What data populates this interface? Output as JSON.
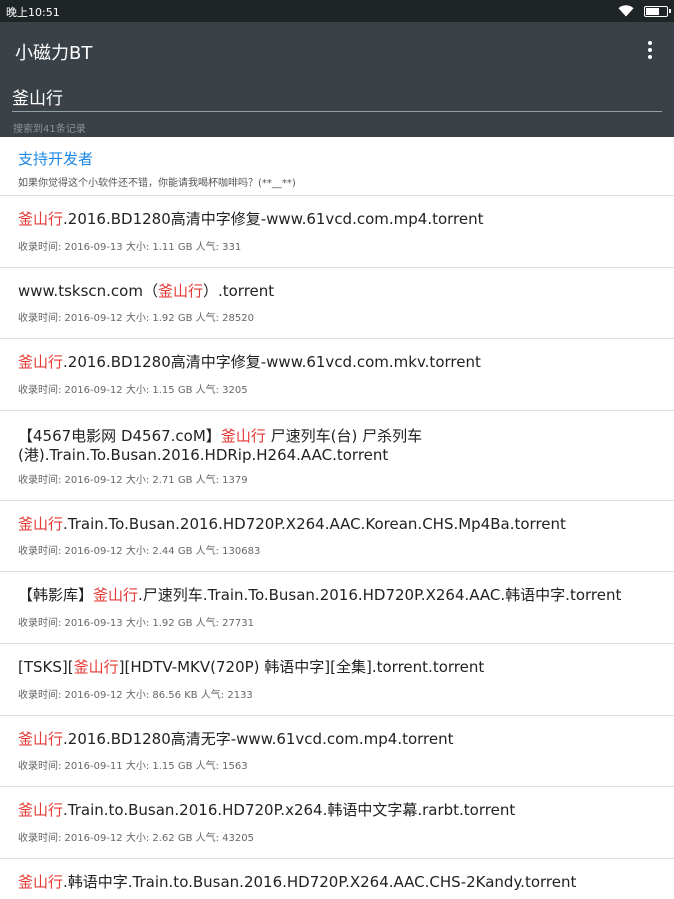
{
  "status_bar": {
    "time": "晚上10:51"
  },
  "app_bar": {
    "title": "小磁力BT",
    "search_value": "釜山行",
    "result_count": "搜索到41条记录"
  },
  "support": {
    "title": "支持开发者",
    "subtitle": "如果你觉得这个小软件还不错，你能请我喝杯咖啡吗？(**__**)"
  },
  "results": [
    {
      "pre": "",
      "hl": "釜山行",
      "post": ".2016.BD1280高清中字修复-www.61vcd.com.mp4.torrent",
      "meta": "收录时间: 2016-09-13 大小: 1.11 GB 人气: 331"
    },
    {
      "pre": "www.tskscn.com（",
      "hl": "釜山行",
      "post": "）.torrent",
      "meta": "收录时间: 2016-09-12 大小: 1.92 GB 人气: 28520"
    },
    {
      "pre": "",
      "hl": "釜山行",
      "post": ".2016.BD1280高清中字修复-www.61vcd.com.mkv.torrent",
      "meta": "收录时间: 2016-09-12 大小: 1.15 GB 人气: 3205"
    },
    {
      "pre": "【4567电影网 D4567.coM】",
      "hl": "釜山行",
      "post": " 尸速列车(台) 尸杀列车(港).Train.To.Busan.2016.HDRip.H264.AAC.torrent",
      "meta": "收录时间: 2016-09-12 大小: 2.71 GB 人气: 1379",
      "tall": true
    },
    {
      "pre": "",
      "hl": "釜山行",
      "post": ".Train.To.Busan.2016.HD720P.X264.AAC.Korean.CHS.Mp4Ba.torrent",
      "meta": "收录时间: 2016-09-12 大小: 2.44 GB 人气: 130683"
    },
    {
      "pre": "【韩影库】",
      "hl": "釜山行",
      "post": ".尸速列车.Train.To.Busan.2016.HD720P.X264.AAC.韩语中字.torrent",
      "meta": "收录时间: 2016-09-13 大小: 1.92 GB 人气: 27731"
    },
    {
      "pre": "[TSKS][",
      "hl": "釜山行",
      "post": "][HDTV-MKV(720P) 韩语中字][全集].torrent.torrent",
      "meta": "收录时间: 2016-09-12 大小: 86.56 KB 人气: 2133"
    },
    {
      "pre": "",
      "hl": "釜山行",
      "post": ".2016.BD1280高清无字-www.61vcd.com.mp4.torrent",
      "meta": "收录时间: 2016-09-11 大小: 1.15 GB 人气: 1563"
    },
    {
      "pre": "",
      "hl": "釜山行",
      "post": ".Train.to.Busan.2016.HD720P.x264.韩语中文字幕.rarbt.torrent",
      "meta": "收录时间: 2016-09-12 大小: 2.62 GB 人气: 43205"
    },
    {
      "pre": "",
      "hl": "釜山行",
      "post": ".韩语中字.Train.to.Busan.2016.HD720P.X264.AAC.CHS-2Kandy.torrent",
      "meta": ""
    }
  ]
}
